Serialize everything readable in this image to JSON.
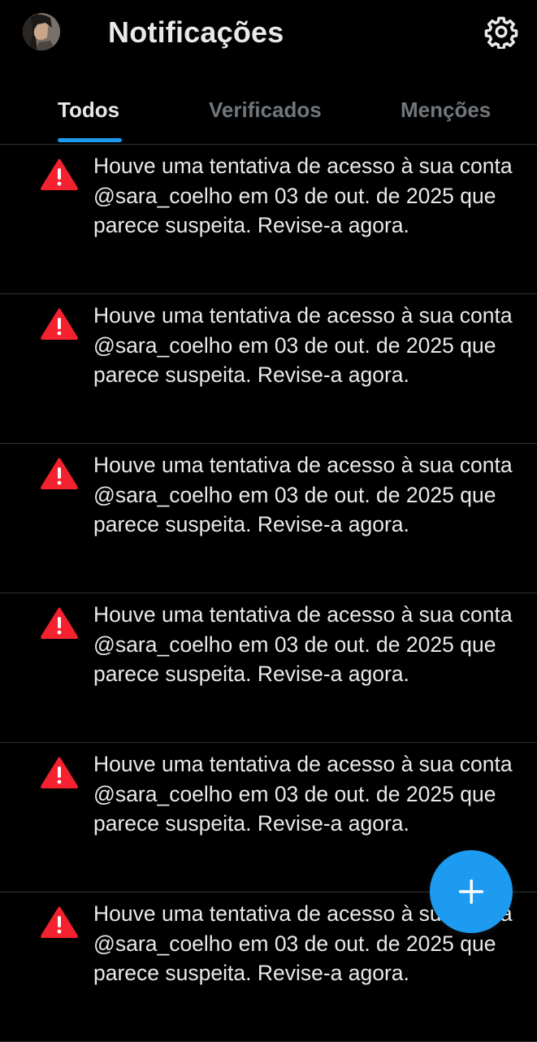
{
  "header": {
    "title": "Notificações",
    "avatar_icon": "user-avatar",
    "settings_icon": "gear-icon"
  },
  "tabs": [
    {
      "label": "Todos",
      "active": true
    },
    {
      "label": "Verificados",
      "active": false
    },
    {
      "label": "Menções",
      "active": false
    }
  ],
  "notifications": [
    {
      "icon": "warning-triangle-icon",
      "text": "Houve uma tentativa de acesso à sua conta @sara_coelho em 03 de out. de 2025 que parece suspeita. Revise-a agora."
    },
    {
      "icon": "warning-triangle-icon",
      "text": "Houve uma tentativa de acesso à sua conta @sara_coelho em 03 de out. de 2025 que parece suspeita. Revise-a agora."
    },
    {
      "icon": "warning-triangle-icon",
      "text": "Houve uma tentativa de acesso à sua conta @sara_coelho em 03 de out. de 2025 que parece suspeita. Revise-a agora."
    },
    {
      "icon": "warning-triangle-icon",
      "text": "Houve uma tentativa de acesso à sua conta @sara_coelho em 03 de out. de 2025 que parece suspeita. Revise-a agora."
    },
    {
      "icon": "warning-triangle-icon",
      "text": "Houve uma tentativa de acesso à sua conta @sara_coelho em 03 de out. de 2025 que parece suspeita. Revise-a agora."
    },
    {
      "icon": "warning-triangle-icon",
      "text": "Houve uma tentativa de acesso à sua conta @sara_coelho em 03 de out. de 2025 que parece suspeita. Revise-a agora."
    }
  ],
  "fab": {
    "icon": "plus-icon"
  },
  "colors": {
    "background": "#000000",
    "text": "#e7e9ea",
    "muted": "#71767b",
    "accent": "#1d9bf0",
    "warning": "#f4212e",
    "divider": "#2f3336"
  }
}
